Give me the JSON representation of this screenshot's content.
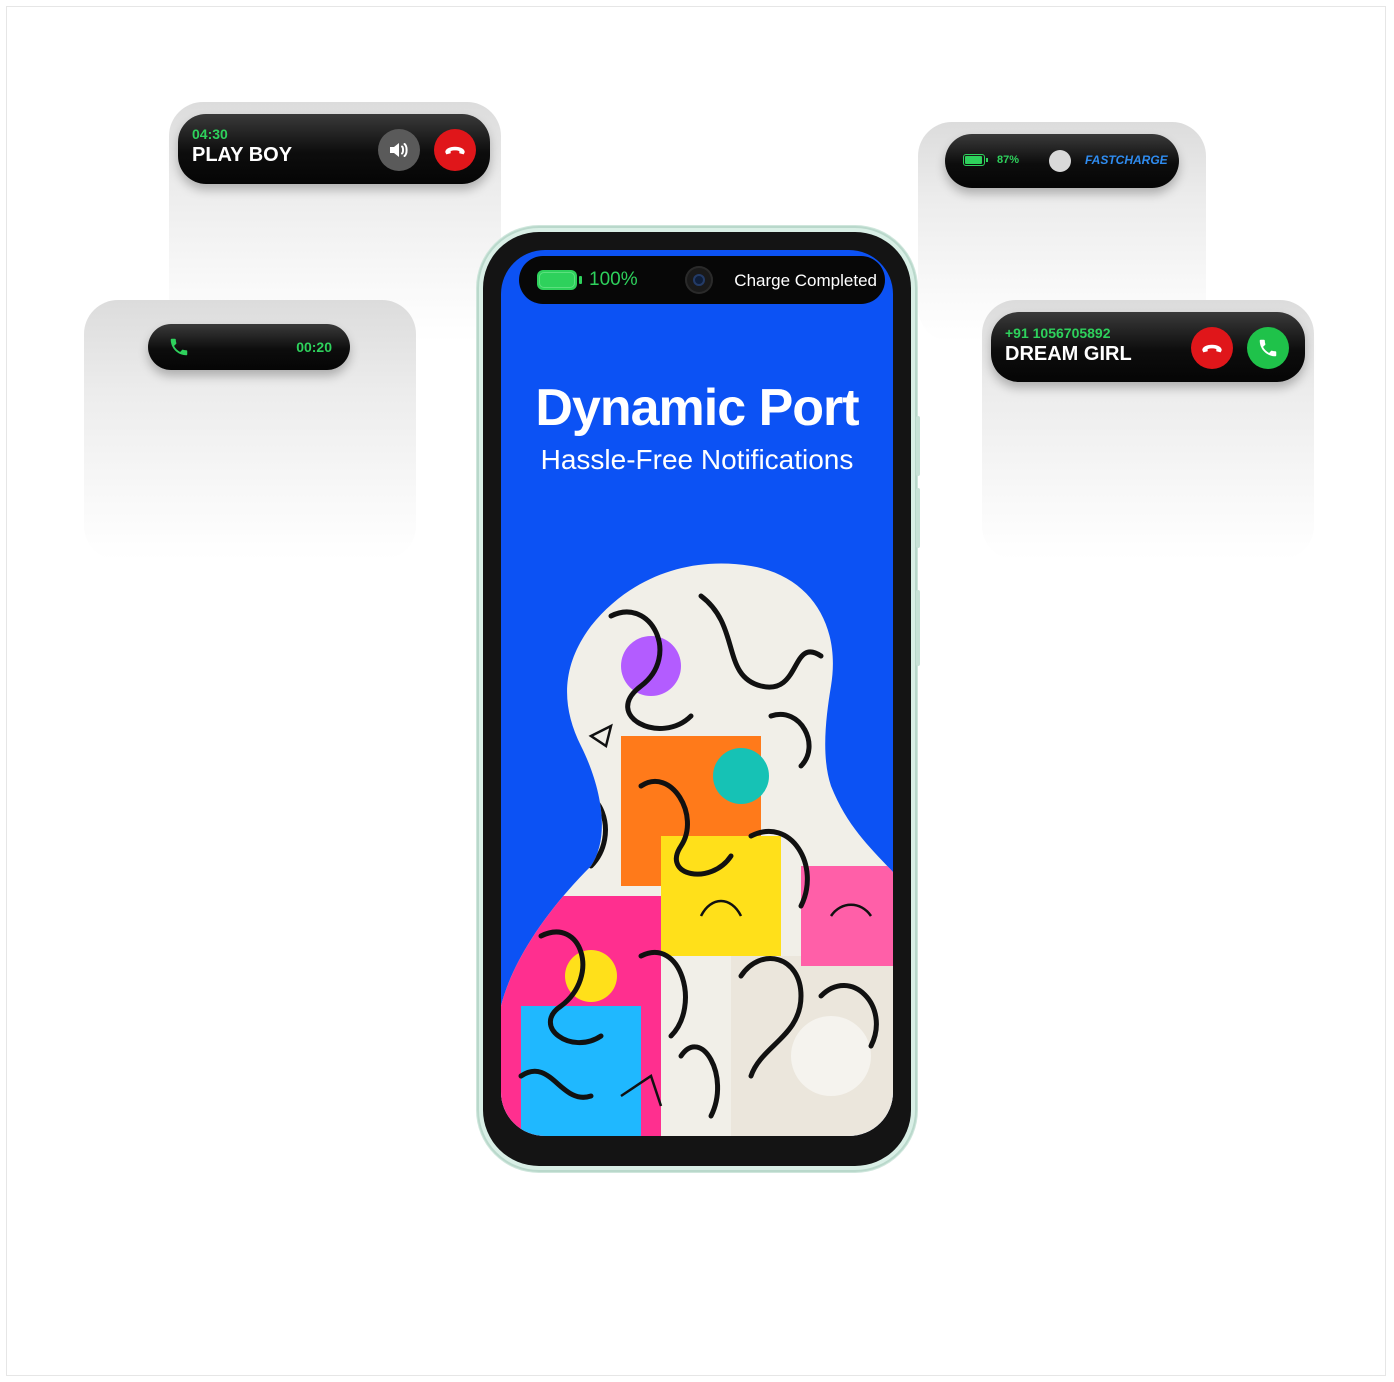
{
  "colors": {
    "screen_blue": "#0c52f4",
    "accent_green": "#2ed15c",
    "decline_red": "#e0161a",
    "accept_green": "#1fc24a",
    "fastcharge_blue": "#2f8cf0"
  },
  "call_pill": {
    "timer": "04:30",
    "caller": "PLAY BOY",
    "icons": [
      "speaker-icon",
      "hang-up-icon"
    ]
  },
  "ongoing_pill": {
    "timer": "00:20",
    "icons": [
      "phone-icon"
    ]
  },
  "charge_pill": {
    "battery_percent": "87%",
    "label": "FASTCHARGE",
    "battery_level": 0.87,
    "icons": [
      "battery-icon"
    ]
  },
  "incoming_pill": {
    "number": "+91 1056705892",
    "caller": "DREAM GIRL",
    "icons": [
      "decline-icon",
      "accept-icon"
    ]
  },
  "phone": {
    "island": {
      "battery_percent": "100%",
      "status": "Charge Completed",
      "battery_level": 1.0,
      "icons": [
        "battery-icon",
        "camera-icon"
      ]
    },
    "headline": "Dynamic Port",
    "subheadline": "Hassle-Free Notifications"
  }
}
